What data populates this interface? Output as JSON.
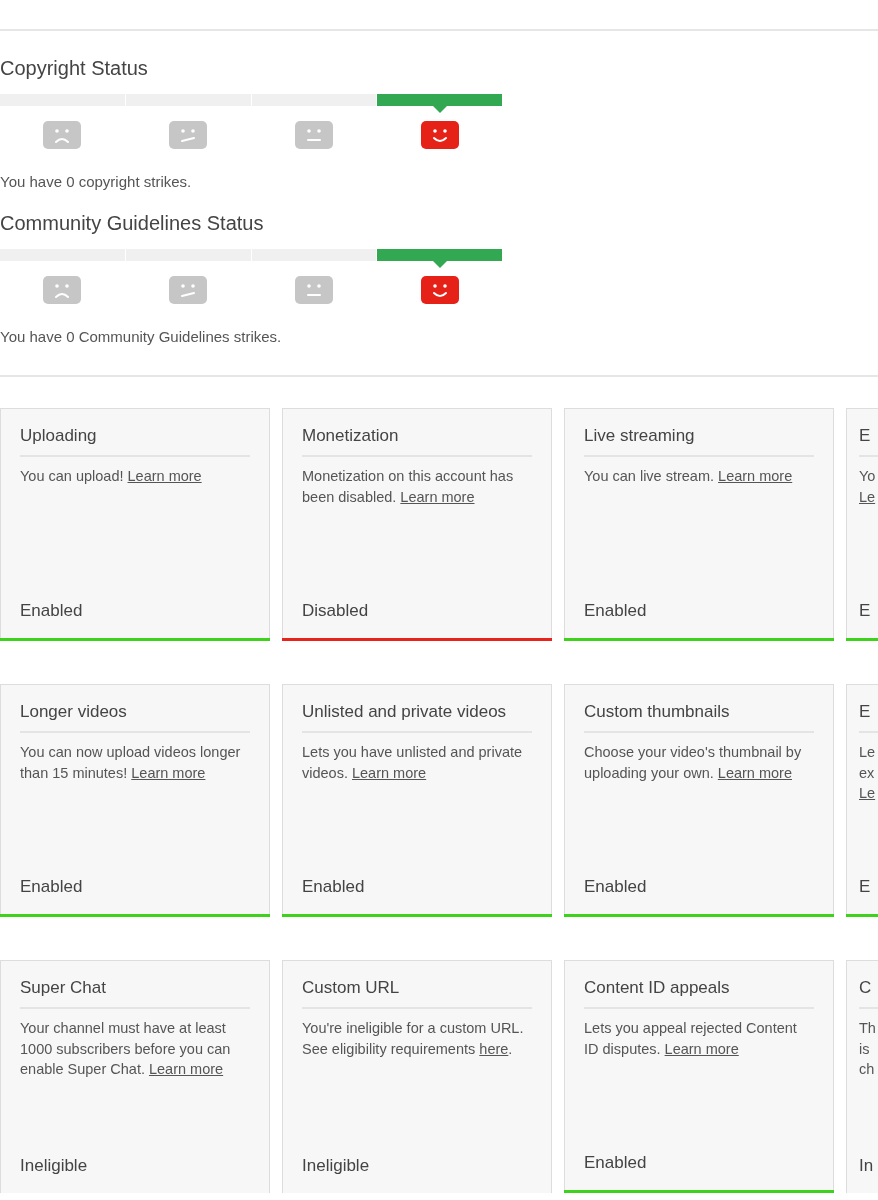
{
  "strike_sections": [
    {
      "title": "Copyright Status",
      "meter": [
        {
          "kind": "sad",
          "selected": false
        },
        {
          "kind": "skeptical",
          "selected": false
        },
        {
          "kind": "neutral",
          "selected": false
        },
        {
          "kind": "happy",
          "selected": true
        }
      ],
      "summary": "You have 0 copyright strikes."
    },
    {
      "title": "Community Guidelines Status",
      "meter": [
        {
          "kind": "sad",
          "selected": false
        },
        {
          "kind": "skeptical",
          "selected": false
        },
        {
          "kind": "neutral",
          "selected": false
        },
        {
          "kind": "happy",
          "selected": true
        }
      ],
      "summary": "You have 0 Community Guidelines strikes."
    }
  ],
  "feature_rows": [
    [
      {
        "title": "Uploading",
        "body": [
          {
            "text": "You can upload! "
          },
          {
            "text": "Learn more",
            "link": true
          }
        ],
        "status": "Enabled",
        "color": "#3fd21c"
      },
      {
        "title": "Monetization",
        "body": [
          {
            "text": "Monetization on this account has been disabled. "
          },
          {
            "text": "Learn more",
            "link": true
          }
        ],
        "status": "Disabled",
        "color": "#e8231c"
      },
      {
        "title": "Live streaming",
        "body": [
          {
            "text": "You can live stream. "
          },
          {
            "text": "Learn more",
            "link": true
          }
        ],
        "status": "Enabled",
        "color": "#3fd21c"
      },
      {
        "kind": "cut",
        "title": "E",
        "lines": [
          {
            "text": "Yo"
          },
          {
            "text": "Le",
            "link": true
          }
        ],
        "status": "E",
        "color": "#3fd21c"
      }
    ],
    [
      {
        "title": "Longer videos",
        "body": [
          {
            "text": "You can now upload videos longer than 15 minutes! "
          },
          {
            "text": "Learn more",
            "link": true
          }
        ],
        "status": "Enabled",
        "color": "#3fd21c"
      },
      {
        "title": "Unlisted and private videos",
        "body": [
          {
            "text": "Lets you have unlisted and private videos. "
          },
          {
            "text": "Learn more",
            "link": true
          }
        ],
        "status": "Enabled",
        "color": "#3fd21c"
      },
      {
        "title": "Custom thumbnails",
        "body": [
          {
            "text": "Choose your video's thumbnail by uploading your own. "
          },
          {
            "text": "Learn more",
            "link": true
          }
        ],
        "status": "Enabled",
        "color": "#3fd21c"
      },
      {
        "kind": "cut",
        "title": "E",
        "lines": [
          {
            "text": "Le"
          },
          {
            "text": "ex"
          },
          {
            "text": "Le",
            "link": true
          }
        ],
        "status": "E",
        "color": "#3fd21c"
      }
    ],
    [
      {
        "title": "Super Chat",
        "body": [
          {
            "text": "Your channel must have at least 1000 subscribers before you can enable Super Chat. "
          },
          {
            "text": "Learn more",
            "link": true
          }
        ],
        "status": "Ineligible"
      },
      {
        "title": "Custom URL",
        "body": [
          {
            "text": "You're ineligible for a custom URL. See eligibility requirements "
          },
          {
            "text": "here",
            "link": true
          },
          {
            "text": "."
          }
        ],
        "status": "Ineligible"
      },
      {
        "title": "Content ID appeals",
        "body": [
          {
            "text": "Lets you appeal rejected Content ID disputes. "
          },
          {
            "text": "Learn more",
            "link": true
          }
        ],
        "status": "Enabled",
        "color": "#3fd21c"
      },
      {
        "kind": "cut",
        "title": "C",
        "lines": [
          {
            "text": "Th"
          },
          {
            "text": "is"
          },
          {
            "text": "ch"
          }
        ],
        "status": "In"
      }
    ]
  ]
}
